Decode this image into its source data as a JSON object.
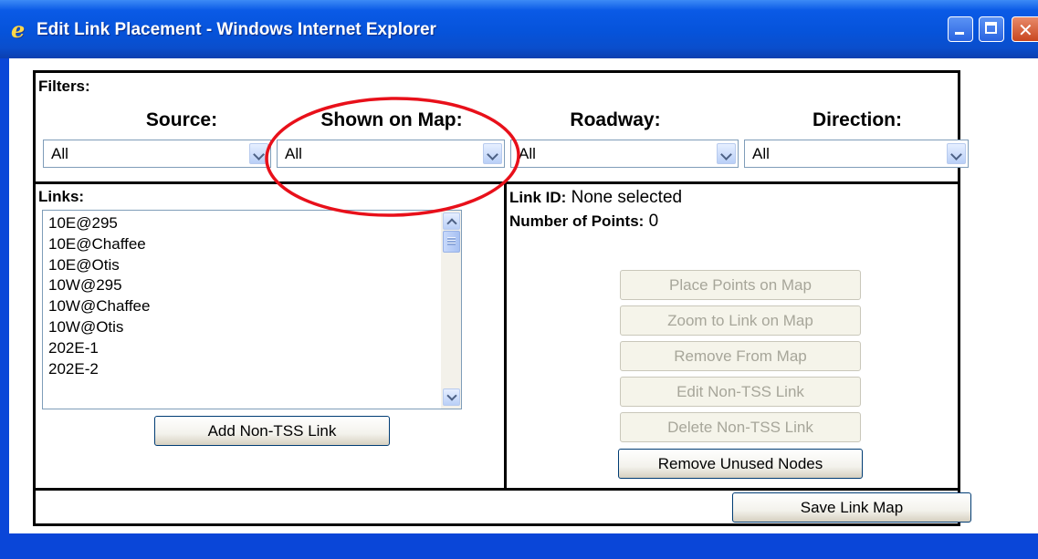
{
  "window": {
    "title": "Edit Link Placement - Windows Internet Explorer"
  },
  "filters": {
    "label": "Filters:",
    "columns": [
      {
        "header": "Source:",
        "value": "All"
      },
      {
        "header": "Shown on Map:",
        "value": "All"
      },
      {
        "header": "Roadway:",
        "value": "All"
      },
      {
        "header": "Direction:",
        "value": "All"
      }
    ]
  },
  "links": {
    "label": "Links:",
    "items": [
      "10E@295",
      "10E@Chaffee",
      "10E@Otis",
      "10W@295",
      "10W@Chaffee",
      "10W@Otis",
      "202E-1",
      "202E-2"
    ],
    "add_button": "Add Non-TSS Link"
  },
  "info": {
    "link_id_label": "Link ID:",
    "link_id_value": "None selected",
    "points_label": "Number of Points:",
    "points_value": "0"
  },
  "actions": {
    "place_points": "Place Points on Map",
    "zoom_to_link": "Zoom to Link on Map",
    "remove_from_map": "Remove From Map",
    "edit_non_tss": "Edit Non-TSS Link",
    "delete_non_tss": "Delete Non-TSS Link",
    "remove_unused_nodes": "Remove Unused Nodes",
    "save_link_map": "Save Link Map"
  },
  "colors": {
    "annotation": "#e8101a",
    "titlebar": "#0653da"
  },
  "icons": [
    "ie-logo-icon",
    "minimize-icon",
    "maximize-icon",
    "close-icon"
  ]
}
